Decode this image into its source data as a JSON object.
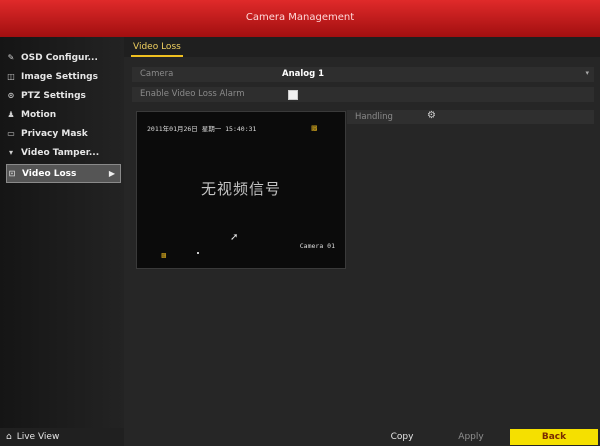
{
  "window": {
    "title": "Camera Management"
  },
  "sidebar": {
    "items": [
      {
        "label": "OSD Configur...",
        "icon": "pencil-icon"
      },
      {
        "label": "Image Settings",
        "icon": "image-icon"
      },
      {
        "label": "PTZ Settings",
        "icon": "ptz-icon"
      },
      {
        "label": "Motion",
        "icon": "motion-icon"
      },
      {
        "label": "Privacy Mask",
        "icon": "mask-icon"
      },
      {
        "label": "Video Tamper...",
        "icon": "tamper-icon"
      },
      {
        "label": "Video Loss",
        "icon": "video-loss-icon",
        "active": true
      }
    ],
    "live_view": "Live View"
  },
  "tabs": [
    {
      "label": "Video Loss",
      "active": true
    }
  ],
  "form": {
    "camera_label": "Camera",
    "camera_value": "Analog  1",
    "enable_label": "Enable Video Loss Alarm",
    "enable_checked": true,
    "handling_label": "Handling"
  },
  "preview": {
    "osd_date": "2011年01月26日  星期一  15:40:31",
    "no_video_text": "无视频信号",
    "osd_camera": "Camera 01"
  },
  "buttons": {
    "copy": "Copy",
    "apply": "Apply",
    "back": "Back"
  },
  "colors": {
    "title_red": "#c8191a",
    "tab_yellow": "#f0c020",
    "back_yellow": "#f5e000"
  }
}
